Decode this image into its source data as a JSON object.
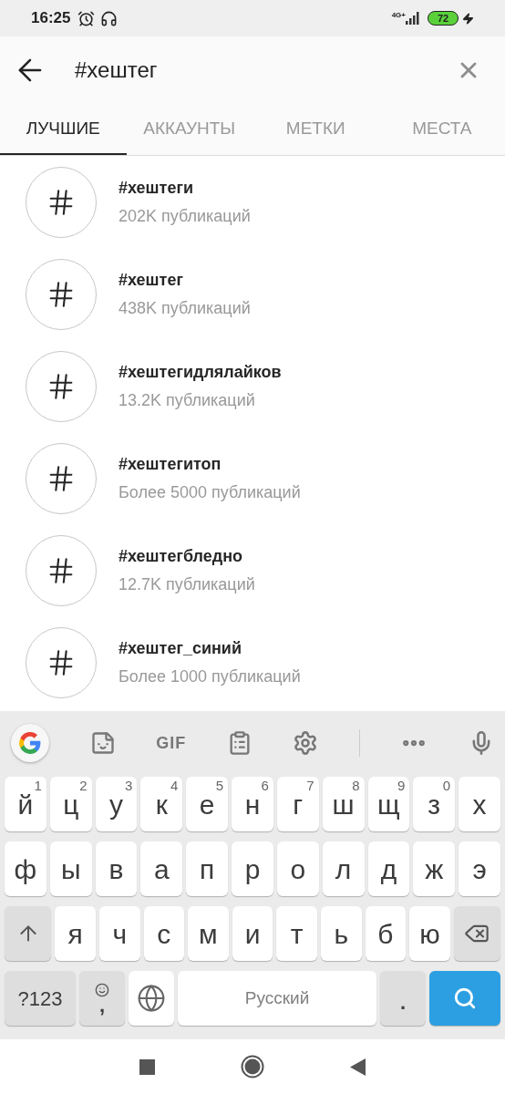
{
  "status_bar": {
    "time": "16:25",
    "network": "4G+",
    "battery": "72"
  },
  "search": {
    "value": "#хештег"
  },
  "tabs": [
    {
      "label": "ЛУЧШИЕ",
      "selected": true
    },
    {
      "label": "АККАУНТЫ",
      "selected": false
    },
    {
      "label": "МЕТКИ",
      "selected": false
    },
    {
      "label": "МЕСТА",
      "selected": false
    }
  ],
  "results": [
    {
      "title": "#хештеги",
      "subtitle": "202K публикаций"
    },
    {
      "title": "#хештег",
      "subtitle": "438K публикаций"
    },
    {
      "title": "#хештегидлялайков",
      "subtitle": "13.2K публикаций"
    },
    {
      "title": "#хештегитоп",
      "subtitle": "Более 5000 публикаций"
    },
    {
      "title": "#хештегбледно",
      "subtitle": "12.7K публикаций"
    },
    {
      "title": "#хештег_синий",
      "subtitle": "Более 1000 публикаций"
    }
  ],
  "keyboard": {
    "toolbar_gif": "GIF",
    "rows": [
      {
        "keys": [
          {
            "kind": "letter",
            "label": "й",
            "hint": "1"
          },
          {
            "kind": "letter",
            "label": "ц",
            "hint": "2"
          },
          {
            "kind": "letter",
            "label": "у",
            "hint": "3"
          },
          {
            "kind": "letter",
            "label": "к",
            "hint": "4"
          },
          {
            "kind": "letter",
            "label": "е",
            "hint": "5"
          },
          {
            "kind": "letter",
            "label": "н",
            "hint": "6"
          },
          {
            "kind": "letter",
            "label": "г",
            "hint": "7"
          },
          {
            "kind": "letter",
            "label": "ш",
            "hint": "8"
          },
          {
            "kind": "letter",
            "label": "щ",
            "hint": "9"
          },
          {
            "kind": "letter",
            "label": "з",
            "hint": "0"
          },
          {
            "kind": "letter",
            "label": "х"
          }
        ]
      },
      {
        "keys": [
          {
            "kind": "letter",
            "label": "ф"
          },
          {
            "kind": "letter",
            "label": "ы"
          },
          {
            "kind": "letter",
            "label": "в"
          },
          {
            "kind": "letter",
            "label": "а"
          },
          {
            "kind": "letter",
            "label": "п"
          },
          {
            "kind": "letter",
            "label": "р"
          },
          {
            "kind": "letter",
            "label": "о"
          },
          {
            "kind": "letter",
            "label": "л"
          },
          {
            "kind": "letter",
            "label": "д"
          },
          {
            "kind": "letter",
            "label": "ж"
          },
          {
            "kind": "letter",
            "label": "э"
          }
        ]
      },
      {
        "keys": [
          {
            "kind": "shift"
          },
          {
            "kind": "letter",
            "label": "я"
          },
          {
            "kind": "letter",
            "label": "ч"
          },
          {
            "kind": "letter",
            "label": "с"
          },
          {
            "kind": "letter",
            "label": "м"
          },
          {
            "kind": "letter",
            "label": "и"
          },
          {
            "kind": "letter",
            "label": "т"
          },
          {
            "kind": "letter",
            "label": "ь"
          },
          {
            "kind": "letter",
            "label": "б"
          },
          {
            "kind": "letter",
            "label": "ю"
          },
          {
            "kind": "backspace"
          }
        ]
      },
      {
        "keys": [
          {
            "kind": "symbols",
            "label": "?123"
          },
          {
            "kind": "emoji",
            "label": ","
          },
          {
            "kind": "globe"
          },
          {
            "kind": "space",
            "label": "Русский"
          },
          {
            "kind": "period",
            "label": "."
          },
          {
            "kind": "search"
          }
        ]
      }
    ]
  }
}
